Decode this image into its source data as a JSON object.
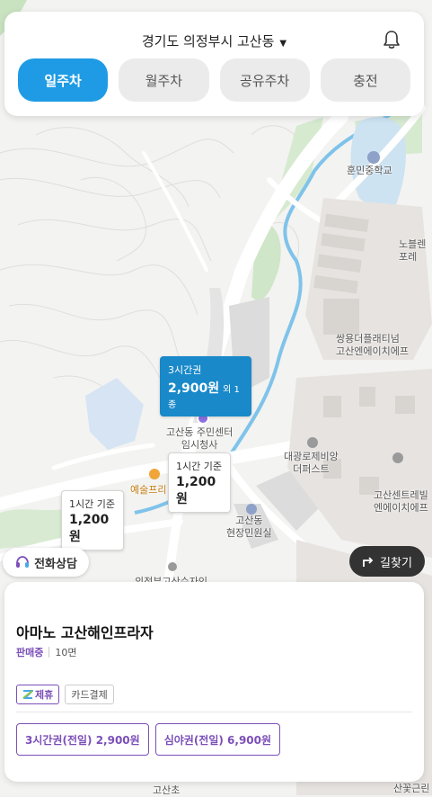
{
  "header": {
    "location": "경기도 의정부시 고산동",
    "caret": "▼",
    "tabs": [
      {
        "label": "일주차",
        "active": true
      },
      {
        "label": "월주차",
        "active": false
      },
      {
        "label": "공유주차",
        "active": false
      },
      {
        "label": "충전",
        "active": false
      }
    ]
  },
  "map": {
    "labels": {
      "school": "훈민중학교",
      "east_top": "노블렌\n포레",
      "apartment1": "쌍용더플래티넘\n고산엔에이치에프",
      "community_center": "고산동 주민센터\n임시청사",
      "apartment2": "대광로제비앙\n더퍼스트",
      "apartment3": "고산센트레빌\n엔에이치에프",
      "art_school": "예술프리",
      "civil_office": "고산동\n현장민원실",
      "bottom1": "의정부고산수자인",
      "bottom2": "산꽃근린",
      "bottom3": "고산초"
    },
    "callouts": [
      {
        "label": "3시간권",
        "price": "2,900원",
        "extra": "외 1종"
      },
      {
        "label": "1시간 기준",
        "price": "1,200원"
      },
      {
        "label": "1시간 기준",
        "price": "1,200원"
      }
    ]
  },
  "buttons": {
    "phone": "전화상담",
    "route": "길찾기"
  },
  "lot": {
    "name": "아마노 고산해인프라자",
    "status": "판매중",
    "spots": "10면",
    "tags": [
      "제휴",
      "카드결제"
    ],
    "tickets": [
      "3시간권(전일) 2,900원",
      "심야권(전일) 6,900원"
    ]
  },
  "colors": {
    "accent": "#1e9be4",
    "purple": "#7b4fb8",
    "stream": "#57b5e8",
    "park": "#c9e3c1"
  }
}
